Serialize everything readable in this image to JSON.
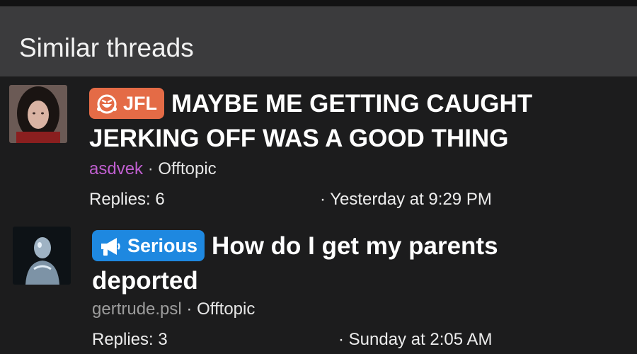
{
  "header": {
    "title": "Similar threads"
  },
  "threads": [
    {
      "prefix": "JFL",
      "prefix_color": "#e46b46",
      "prefix_icon": "laughing-emoji-icon",
      "title": "MAYBE ME GETTING CAUGHT JERKING OFF WAS A GOOD THING",
      "author": "asdvek",
      "author_color": "#c05fd0",
      "separator": "·",
      "forum": "Offtopic",
      "replies": "Replies: 6",
      "date": "· Yesterday at 9:29 PM"
    },
    {
      "prefix": "Serious",
      "prefix_color": "#1e88e0",
      "prefix_icon": "megaphone-icon",
      "title": "How do I get my parents deported",
      "author": "gertrude.psl",
      "author_color": "#9c9c9c",
      "separator": "·",
      "forum": "Offtopic",
      "replies": "Replies: 3",
      "date": "· Sunday at 2:05 AM"
    }
  ]
}
